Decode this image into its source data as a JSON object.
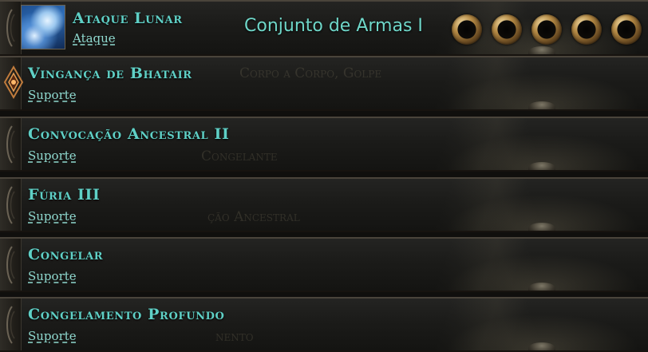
{
  "skill": {
    "name": "Ataque Lunar",
    "type": "Ataque",
    "weapon_set_label": "Conjunto de Armas I",
    "icon": "lunar-strike-gem-icon"
  },
  "sockets": [
    {
      "icon": "empty-socket-icon"
    },
    {
      "icon": "empty-socket-icon"
    },
    {
      "icon": "empty-socket-icon"
    },
    {
      "icon": "empty-socket-icon"
    },
    {
      "icon": "empty-socket-icon"
    }
  ],
  "supports": [
    {
      "name": "Vingança de Bhatair",
      "type": "Suporte"
    },
    {
      "name": "Convocação Ancestral II",
      "type": "Suporte"
    },
    {
      "name": "Fúria III",
      "type": "Suporte"
    },
    {
      "name": "Congelar",
      "type": "Suporte"
    },
    {
      "name": "Congelamento Profundo",
      "type": "Suporte"
    }
  ],
  "ghost_texts": [
    "Corpo a Corpo, Golpe",
    "Congelante",
    "ção Ancestral",
    "nento"
  ],
  "colors": {
    "gem_text": "#5fd0c6",
    "socket_gold": "#b58a45"
  }
}
